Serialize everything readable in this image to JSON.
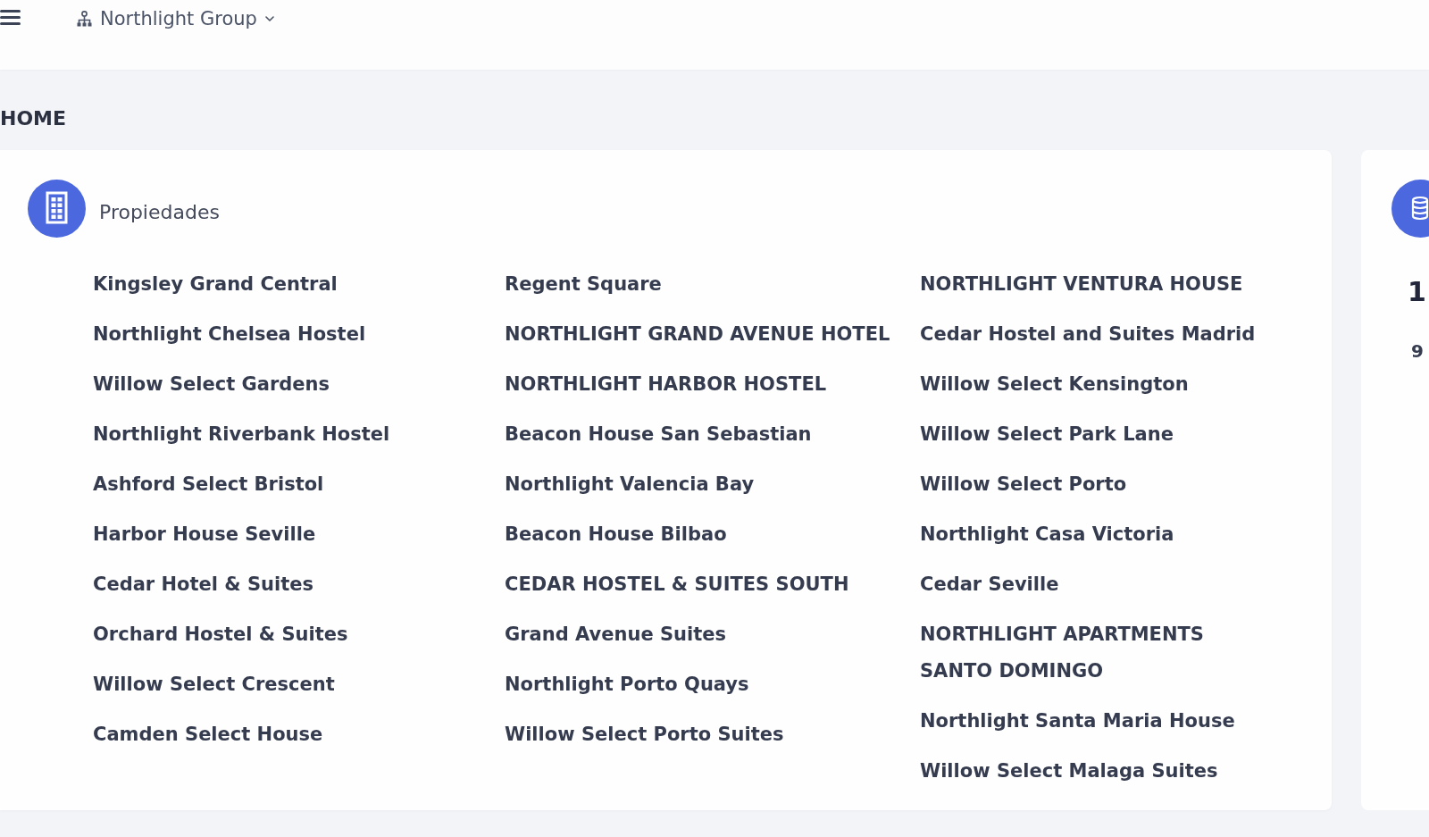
{
  "topbar": {
    "organization": "Northlight Group"
  },
  "page_title": "HOME",
  "properties_card": {
    "title": "Propiedades",
    "columns": [
      [
        "Kingsley Grand Central",
        "Northlight Chelsea Hostel",
        "Willow Select Gardens",
        "Northlight Riverbank Hostel",
        "Ashford Select Bristol",
        "Harbor House Seville",
        "Cedar Hotel & Suites",
        "Orchard Hostel & Suites",
        "Willow Select Crescent",
        "Camden Select House"
      ],
      [
        "Regent Square",
        "NORTHLIGHT GRAND AVENUE HOTEL",
        "NORTHLIGHT HARBOR HOSTEL",
        "Beacon House San Sebastian",
        "Northlight Valencia Bay",
        "Beacon House Bilbao",
        "CEDAR HOSTEL & SUITES SOUTH",
        "Grand Avenue Suites",
        "Northlight Porto Quays",
        "Willow Select Porto Suites"
      ],
      [
        "NORTHLIGHT VENTURA HOUSE",
        "Cedar Hostel and Suites Madrid",
        "Willow Select Kensington",
        "Willow Select Park Lane",
        "Willow Select Porto",
        "Northlight Casa Victoria",
        "Cedar Seville",
        "NORTHLIGHT APARTMENTS SANTO DOMINGO",
        "Northlight Santa Maria House",
        "Willow Select Malaga Suites"
      ]
    ]
  },
  "side_card": {
    "value": "1",
    "subtext": "9"
  }
}
